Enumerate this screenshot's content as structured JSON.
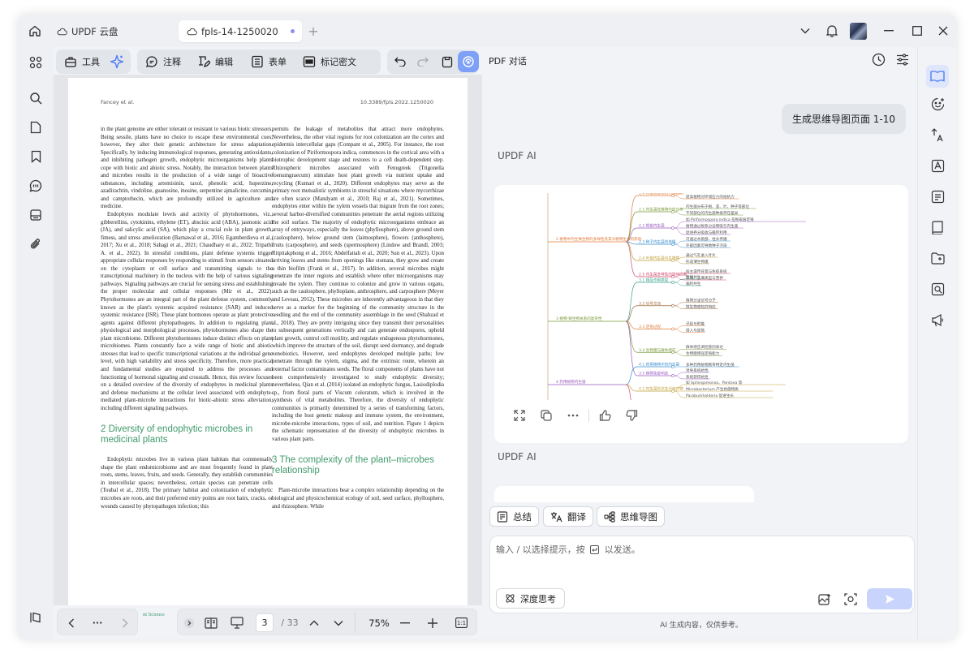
{
  "titlebar": {
    "home_icon": "home-icon",
    "cloud_tab": "UPDF 云盘",
    "doc_tab": "fpls-14-1250020",
    "new_tab": "+",
    "chevron": "chevron-down-icon",
    "bell": "bell-icon",
    "minimize": "minimize-icon",
    "maximize": "maximize-icon",
    "close": "close-icon"
  },
  "toolbar": {
    "tools": "工具",
    "comment": "注释",
    "edit": "编辑",
    "form": "表单",
    "redact": "标记密文"
  },
  "page": {
    "header_left": "Fancey et al.",
    "header_right": "10.3389/fpls.2022.1250020",
    "left_col": [
      {
        "t": "p",
        "noind": true,
        "text": "in the plant genome are either tolerant or resistant to various biotic stressors. Being sessile, plants have no choice to escape these environmental cues; however, they alter their genetic architecture for stress adaptation. Specifically, by inducing immunological responses, generating antioxidants, and inhibiting pathogen growth, endophytic microorganisms help plants cope with biotic and abiotic stress. Notably, the interaction between plants and microbes results in the production of a wide range of bioactive substances, including artemisinin, taxol, phenolic acid, huperzine, azadirachtin, vindoline, guanosine, inosine, serpentine ajmalicine, curcumin, and camptothecin, which are profoundly utilized in agriculture and medicine."
      },
      {
        "t": "p",
        "text": "Endophytes modulate levels and activity of phytohormones, viz., gibberellins, cytokinins, ethylene (ET), abscisic acid (ABA), jasmonic acid (JA), and salicylic acid (SA), which play a crucial role in plant growth, fitness, and stress amelioration (Barnawal et al., 2016; Egamberdieva et al., 2017; Xu et al., 2018; Sahagi et al., 2021; Chaudhary et al., 2022; Tripathi A. et al., 2022). In stressful conditions, plant defense systems trigger appropriate cellular responses by responding to stimuli from sensors situated on the cytoplasm or cell surface and transmitting signals to the transcriptional machinery in the nucleus with the help of various signaling pathways. Signaling pathways are crucial for sensing stress and establishing the proper molecular and cellular responses (Mir et al., 2022). Phytohormones are an integral part of the plant defense system, commonly known as the plant's systemic acquired resistance (SAR) and induced systemic resistance (ISR). These plant hormones operate as plant protective agents against different phytopathogens. In addition to regulating plant physiological and morphological processes, phytohormones also shape the plant microbiome. Different phytohormones induce distinct effects on plant microbiomes. Plants constantly face a wide range of biotic and abiotic stresses that lead to specific transcriptional variations at the individual gene level, with high variability and stress specificity. Therefore, more practical and fundamental studies are required to address the processes and functioning of hormonal signaling and crosstalk. Hence, this review focuses on a detailed overview of the diversity of endophytes in medicinal plants and defense mechanisms at the cellular level associated with endophyte-mediated plant-microbe interactions for biotic-abiotic stress alleviation, including different signaling pathways."
      },
      {
        "t": "h",
        "text": "2 Diversity of endophytic microbes in medicinal plants"
      },
      {
        "t": "p",
        "text": "Endophytic microbes live in various plant habitats that commensally shape the plant endomicrobiome and are most frequently found in plant roots, stems, leaves, fruits, and seeds. Generally, they establish communities in intercellular spaces; nevertheless, certain species can penetrate cells (Toubal et al., 2018). The primary habitat and colonization of endophytic microbes are roots, and their preferred entry points are root hairs, cracks, or wounds caused by phytopathogen infection; this"
      }
    ],
    "right_col": [
      {
        "t": "p",
        "noind": true,
        "text": "permits the leakage of metabolites that attract more endophytes. Nevertheless, the other vital regions for root colonization are the cortex and epidermis intercellular gaps (Compant et al., 2005). For instance, the root colonization of Piriformospora indica, commences in the cortical area with a biotrophic development stage and restores to a cell death-dependent step. Rhizospheric microbes associated with Fenugreek (Trigonella foenumgraecum) stimulate host plant growth via nutrient uptake and recycling (Kumari et al., 2020). Different endophytes may serve as the primary root mutualistic symbionts in stressful situations where mycorrhizae are often scarce (Mandyam et al., 2010; Raj et al., 2021). Sometimes, endophytes enter within the xylem vessels that migrate from the root zones; several harbor-diversified communities penetrate the aerial regions utilizing the soil surface. The majority of endophytic microorganisms embrace an array of entryways, especially the leaves (phyllosphere), above ground stem (caulosphere), below ground stem (laimosphere), flowers (anthosphere), fruits (carposphere), and seeds (spermosphere) (Lindow and Brandl, 2003; Ritpitakphong et al., 2016; Abdelfattah et al., 2020; Sun et al., 2023). Upon arriving leaves and stems from openings like stomata, they grow and create a thin biofilm (Frank et al., 2017). In addition, several microbes might penetrate the inner regions and establish where other microorganisms may invade the xylem. They continue to colonize and grow in various organs, such as the caulosphere, phylloplane, anthrosphere, and carposphere (Meyer and Leveau, 2012). These microbes are inherently advantageous in that they serve as a marker for the beginning of the community structure in the seedling and the end of the community assemblage in the seed (Shahzad et al., 2018). They are pretty intriguing since they transmit their personalities to subsequent generations vertically and can generate endospores, uphold plant growth, control cell motility, and regulate endogenous phytohormones, which improve the structure of the soil, disrupt seed dormancy, and degrade xenobiotics. However, seed endophytes developed multiple paths; few penetrate through the xylem, stigma, and the extrinsic route, wherein an external factor contaminates seeds. The floral components of plants have not been comprehensively investigated to study endophytic diversity; nevertheless, Qian et al. (2014) isolated an endophytic fungus, Lasiodiplodia sp., from floral parts of Viscum coloratum, which is involved in the synthesis of vital metabolites. Therefore, the diversity of endophytic communities is primarily determined by a series of transforming factors, including the host genetic makeup and immune system, the environment, microbe-microbe interactions, types of soil, and nutrition. Figure 1 depicts the schematic representation of the diversity of endophytic microbes in various plant parts."
      },
      {
        "t": "h",
        "text": "3 The complexity of the plant–microbes relationship"
      },
      {
        "t": "p",
        "text": "Plant-microbe interactions bear a complex relationship depending on the biological and physicochemical ecology of soil, seed surface, phyllosphere, and rhizosphere. While"
      }
    ],
    "footer_left_fragment": "nt Science"
  },
  "bottombar": {
    "page_current": "3",
    "page_total": "/ 33",
    "zoom": "75%",
    "more": "···"
  },
  "chat": {
    "title": "PDF 对话",
    "user_message": "生成思维导图页面 1-10",
    "ai_label": "UPDF AI",
    "ai_label_2": "UPDF AI",
    "chips": [
      "总结",
      "翻译",
      "思维导图"
    ],
    "input_placeholder": "输入 / 以选择提示，按",
    "input_placeholder_tail": "以发送。",
    "deep_think": "深度思考",
    "footnote": "AI 生成内容，仅供参考。",
    "mindmap": {
      "root": "...",
      "branches": [
        {
          "label": "2 植物中内生微生物的多样性及其对植物生长的影响",
          "children": [
            {
              "label": "1.4 内生微生物的作用机制",
              "leaves": [
                "通过调节植物激素水平",
                "提高植物对环境压力的抵抗力"
              ]
            },
            {
              "label": "2.1 内生菌在植物中的分布",
              "leaves": [
                "内生菌分布于根、茎、叶、种子等部位",
                "不同部位的内生菌种类存在差异"
              ]
            },
            {
              "label": "2.2 根部内生菌",
              "leaves": [
                "如 Piriformospora indica 在根皮层定殖",
                "植物通过根系分泌物吸引内生菌",
                "促进养分吸收与循环利用"
              ]
            },
            {
              "label": "2.3 种子内生菌的传播",
              "leaves": [
                "可通过木质部、柱头传播",
                "外部因素可导致种子污染"
              ]
            },
            {
              "label": "2.4 叶部内生菌与生物膜",
              "leaves": [
                "通过气孔进入叶片",
                "形成薄生物膜"
              ]
            },
            {
              "label": "2.5 内生菌多样性的影响因素",
              "leaves": [
                "宿主遗传背景与免疫系统",
                "环境、土壤类型与营养"
              ]
            }
          ]
        },
        {
          "label": "3 植物-微生物关系的复杂性",
          "children": [
            {
              "label": "3.1 相互作用类型",
              "leaves": [
                "互利共生",
                "偏利共生"
              ]
            },
            {
              "label": "3.2 信号交流",
              "leaves": [
                "植物分泌信号分子",
                "微生物感知并响应"
              ]
            },
            {
              "label": "3.3 定殖过程",
              "leaves": [
                "识别与附着",
                "侵入与定殖"
              ]
            },
            {
              "label": "3.4 生物膜与群体感应",
              "leaves": [
                "群体感应调控基因表达",
                "生物膜增强定殖能力"
              ]
            },
            {
              "label": "3.5 植物免疫响应",
              "leaves": [
                "诱导系统抗性",
                "系统获得抗性"
              ]
            }
          ]
        },
        {
          "label": "4 药用植物内生菌",
          "children": [
            {
              "label": "4.1 药用植物中的内生菌",
              "leaves": [
                "多种药用植物携带特定内生菌"
              ]
            },
            {
              "label": "4.2 内生菌的次生代谢产物",
              "leaves": [
                "如 Sphingomonas、Pantoea 等",
                "Microbacterium 产生抗菌物质",
                "Paraburkholderia 促进生长"
              ]
            },
            {
              "label": "4.3 内生菌的应用",
              "leaves": [
                "农业与医药领域"
              ]
            }
          ]
        }
      ]
    }
  },
  "colors": {
    "accent": "#3f9a6b",
    "ai_blue": "#4f7cf7",
    "send_disabled": "#c8d4fb"
  }
}
